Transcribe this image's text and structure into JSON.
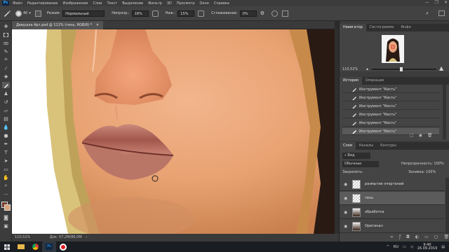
{
  "menubar": {
    "app_icon": "Ps",
    "items": [
      "Файл",
      "Редактирование",
      "Изображение",
      "Слои",
      "Текст",
      "Выделение",
      "Фильтр",
      "3D",
      "Просмотр",
      "Окно",
      "Справка"
    ],
    "window_controls": [
      "—",
      "❐",
      "✕"
    ]
  },
  "options": {
    "brush_size": "40",
    "mode_label": "Режим:",
    "mode_value": "Нормальный",
    "opacity_label": "Непрозр.:",
    "opacity_value": "16%",
    "flow_label": "Наж.:",
    "flow_value": "15%",
    "smoothing_label": "Сглаживание:",
    "smoothing_value": "0%"
  },
  "document": {
    "tab_title": "Девушка Арт.psd @ 111% (тень, RGB/8) *",
    "zoom": "110,52%",
    "doc_size": "Док: 57,2M/86,0M"
  },
  "navigator": {
    "tabs": [
      "Навигатор",
      "Гистограмма",
      "Инфо"
    ],
    "zoom": "110,52%"
  },
  "history": {
    "tabs": [
      "История",
      "Операции"
    ],
    "items": [
      "Инструмент \"Кисть\"",
      "Инструмент \"Кисть\"",
      "Инструмент \"Кисть\"",
      "Инструмент \"Кисть\"",
      "Инструмент \"Кисть\"",
      "Инструмент \"Кисть\""
    ],
    "selected_index": 5
  },
  "layers": {
    "tabs": [
      "Слои",
      "Каналы",
      "Контуры"
    ],
    "filter_label": "Вид",
    "blend_mode": "Обычные",
    "opacity_label": "Непрозрачность:",
    "opacity_value": "100%",
    "lock_label": "Закрепить:",
    "fill_label": "Заливка:",
    "fill_value": "100%",
    "items": [
      {
        "name": "размытие очертаний",
        "selected": false
      },
      {
        "name": "тень",
        "selected": true
      },
      {
        "name": "обработка",
        "selected": false
      },
      {
        "name": "Оригинал",
        "selected": false
      }
    ]
  },
  "taskbar": {
    "lang": "RU",
    "time": "9:40",
    "date": "16.09.2019"
  },
  "colors": {
    "accent": "#31a8ff",
    "panel_bg": "#3c3c3c",
    "dark_bg": "#2b2b2b"
  }
}
